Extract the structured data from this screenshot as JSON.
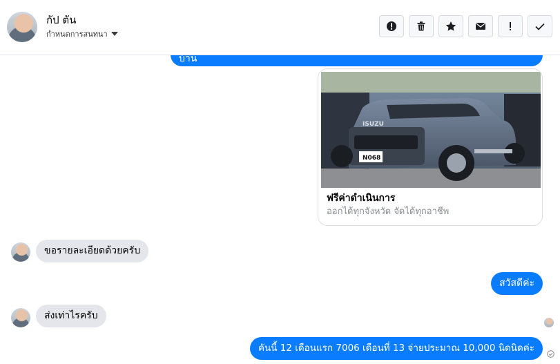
{
  "header": {
    "name": "กัป ตัน",
    "subtitle": "กำหนดการสนทนา"
  },
  "actions": [
    {
      "id": "report",
      "icon": "alert-circle-icon"
    },
    {
      "id": "delete",
      "icon": "trash-icon"
    },
    {
      "id": "star",
      "icon": "star-icon"
    },
    {
      "id": "mail",
      "icon": "envelope-icon"
    },
    {
      "id": "important",
      "icon": "exclamation-icon"
    },
    {
      "id": "done",
      "icon": "check-icon"
    }
  ],
  "messages": {
    "top_out": "บ้าน",
    "card": {
      "title": "ฟรีค่าดำเนินการ",
      "subtitle": "ออกได้ทุกจังหวัด จัดได้ทุกอาชีพ",
      "plate": "N068",
      "brand": "ISUZU"
    },
    "in_1": "ขอรายละเอียดด้วยครับ",
    "out_1": "สวัสดีค่ะ",
    "in_2": "ส่งเท่าไรครับ",
    "out_2": "คันนี้ 12 เดือนแรก 7006 เดือนที่ 13 จ่ายประมาณ 10,000 นิดนิดค่ะ"
  },
  "colors": {
    "outgoing_bubble": "#0a7cff",
    "incoming_bubble": "#e4e6eb"
  }
}
